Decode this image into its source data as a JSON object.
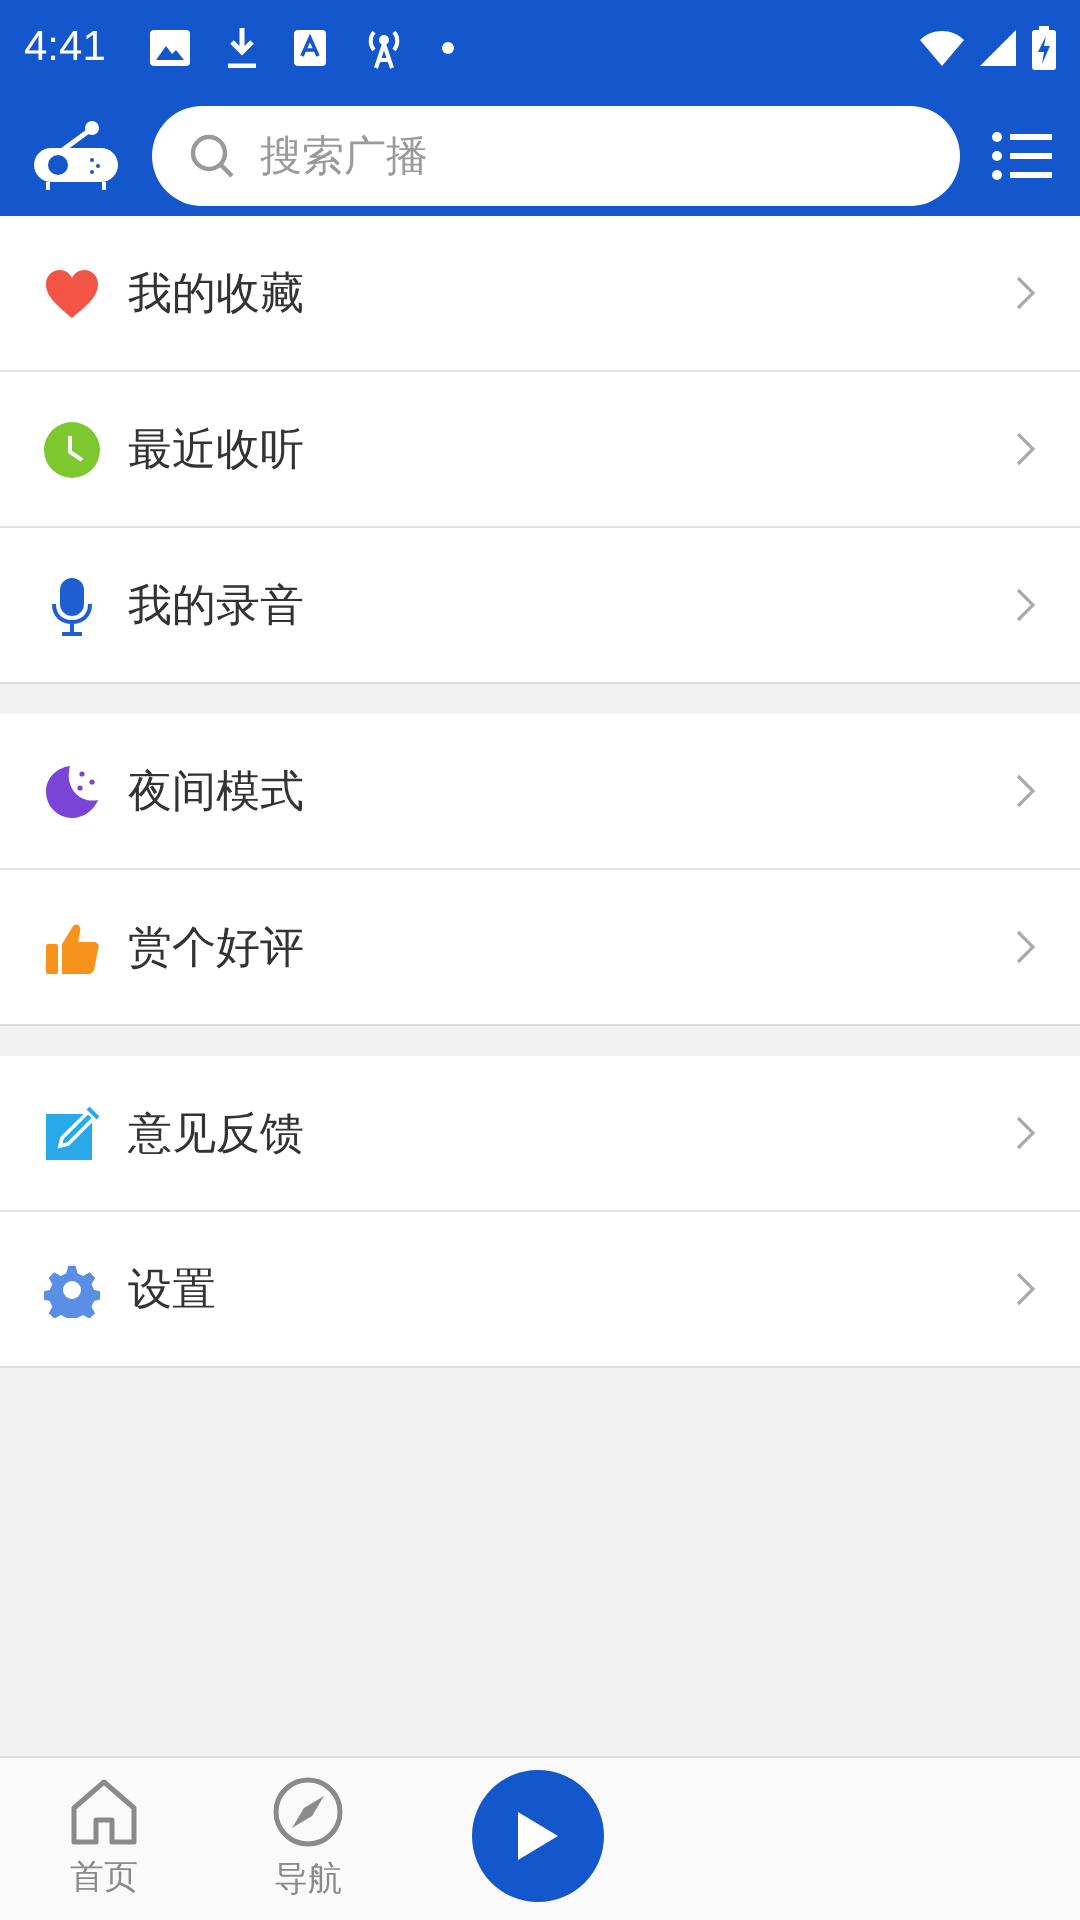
{
  "status_bar": {
    "time": "4:41"
  },
  "header": {
    "search": {
      "placeholder": "搜索广播"
    }
  },
  "menu_groups": [
    {
      "items": [
        {
          "kind": "heart",
          "label": "我的收藏"
        },
        {
          "kind": "clock",
          "label": "最近收听"
        },
        {
          "kind": "mic",
          "label": "我的录音"
        }
      ]
    },
    {
      "items": [
        {
          "kind": "moon",
          "label": "夜间模式"
        },
        {
          "kind": "thumb",
          "label": "赏个好评"
        }
      ]
    },
    {
      "items": [
        {
          "kind": "edit",
          "label": "意见反馈"
        },
        {
          "kind": "gear",
          "label": "设置"
        }
      ]
    }
  ],
  "bottom_nav": {
    "tabs": [
      {
        "kind": "home",
        "label": "首页"
      },
      {
        "kind": "compass",
        "label": "导航"
      }
    ]
  }
}
